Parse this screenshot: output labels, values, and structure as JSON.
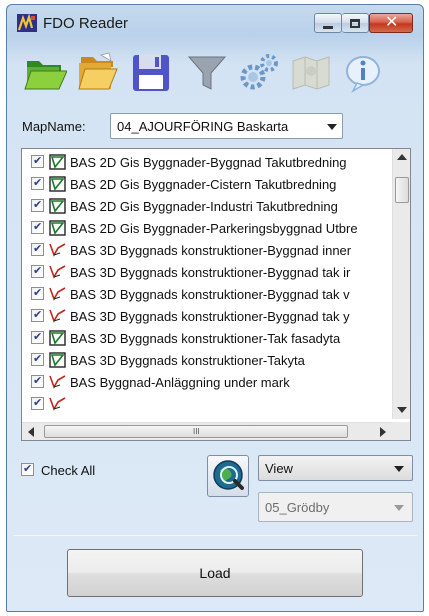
{
  "window": {
    "title": "FDO Reader",
    "controls": {
      "minimize": "–",
      "maximize": "□",
      "close": "✕"
    }
  },
  "toolbar": {
    "tools": [
      {
        "name": "open",
        "icon": "folder-open-icon"
      },
      {
        "name": "open-recent",
        "icon": "folder-stack-icon"
      },
      {
        "name": "save",
        "icon": "floppy-save-icon"
      },
      {
        "name": "filter",
        "icon": "funnel-filter-icon"
      },
      {
        "name": "settings",
        "icon": "gears-icon"
      },
      {
        "name": "map",
        "icon": "map-icon"
      },
      {
        "name": "info",
        "icon": "info-bubble-icon"
      }
    ]
  },
  "mapname": {
    "label": "MapName:",
    "value": "04_AJOURFÖRING Baskarta"
  },
  "layers": [
    {
      "label": "BAS 2D Gis Byggnader-Byggnad Takutbredning",
      "checked": true,
      "type": "polygon"
    },
    {
      "label": "BAS 2D Gis Byggnader-Cistern Takutbredning",
      "checked": true,
      "type": "polygon"
    },
    {
      "label": "BAS 2D Gis Byggnader-Industri Takutbredning",
      "checked": true,
      "type": "polygon"
    },
    {
      "label": "BAS 2D Gis Byggnader-Parkeringsbyggnad Utbre",
      "checked": true,
      "type": "polygon"
    },
    {
      "label": "BAS 3D Byggnads konstruktioner-Byggnad inner",
      "checked": true,
      "type": "line"
    },
    {
      "label": "BAS 3D Byggnads konstruktioner-Byggnad tak ir",
      "checked": true,
      "type": "line"
    },
    {
      "label": "BAS 3D Byggnads konstruktioner-Byggnad tak v",
      "checked": true,
      "type": "line"
    },
    {
      "label": "BAS 3D Byggnads konstruktioner-Byggnad tak y",
      "checked": true,
      "type": "line"
    },
    {
      "label": "BAS 3D Byggnads konstruktioner-Tak fasadyta",
      "checked": true,
      "type": "polygon"
    },
    {
      "label": "BAS 3D Byggnads konstruktioner-Takyta",
      "checked": true,
      "type": "polygon"
    },
    {
      "label": "BAS Byggnad-Anläggning under mark",
      "checked": true,
      "type": "line"
    },
    {
      "label": "",
      "checked": true,
      "type": "line"
    }
  ],
  "hscroll": {
    "grip": "III"
  },
  "check_all": {
    "label": "Check All",
    "checked": true
  },
  "view_select": {
    "value": "View"
  },
  "place_select": {
    "value": "05_Grödby"
  },
  "load_button": {
    "label": "Load"
  },
  "colors": {
    "polygon_icon": "#1d7a2a",
    "line_icon": "#c0281e",
    "check": "#2c3f8f"
  }
}
